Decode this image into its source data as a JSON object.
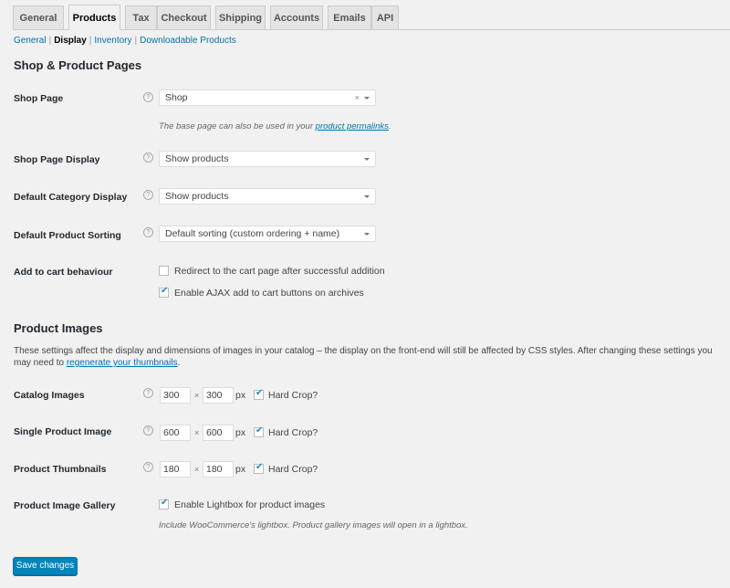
{
  "tabs": [
    {
      "label": "General",
      "active": false
    },
    {
      "label": "Products",
      "active": true
    },
    {
      "label": "Tax",
      "active": false
    },
    {
      "label": "Checkout",
      "active": false
    },
    {
      "label": "Shipping",
      "active": false
    },
    {
      "label": "Accounts",
      "active": false
    },
    {
      "label": "Emails",
      "active": false
    },
    {
      "label": "API",
      "active": false
    }
  ],
  "subnav": {
    "items": [
      "General",
      "Display",
      "Inventory",
      "Downloadable Products"
    ],
    "current": "Display",
    "separator": "|"
  },
  "shop_section": {
    "title": "Shop & Product Pages",
    "help_glyph": "?",
    "shop_page": {
      "label": "Shop Page",
      "value": "Shop",
      "clear_glyph": "×",
      "description_prefix": "The base page can also be used in your ",
      "description_link": "product permalinks",
      "description_suffix": "."
    },
    "shop_page_display": {
      "label": "Shop Page Display",
      "value": "Show products"
    },
    "default_category_display": {
      "label": "Default Category Display",
      "value": "Show products"
    },
    "default_product_sorting": {
      "label": "Default Product Sorting",
      "value": "Default sorting (custom ordering + name)"
    },
    "add_to_cart": {
      "label": "Add to cart behaviour",
      "options": [
        {
          "label": "Redirect to the cart page after successful addition",
          "checked": false
        },
        {
          "label": "Enable AJAX add to cart buttons on archives",
          "checked": true
        }
      ]
    }
  },
  "images_section": {
    "title": "Product Images",
    "intro": "These settings affect the display and dimensions of images in your catalog – the display on the front-end will still be affected by CSS styles. After changing these settings you may need to ",
    "intro_link": "regenerate your thumbnails",
    "intro_suffix": ".",
    "times_glyph": "×",
    "unit": "px",
    "hard_crop_label": "Hard Crop?",
    "rows": [
      {
        "label": "Catalog Images",
        "width": "300",
        "height": "300",
        "hard_crop": true
      },
      {
        "label": "Single Product Image",
        "width": "600",
        "height": "600",
        "hard_crop": true
      },
      {
        "label": "Product Thumbnails",
        "width": "180",
        "height": "180",
        "hard_crop": true
      }
    ],
    "gallery": {
      "label": "Product Image Gallery",
      "option": "Enable Lightbox for product images",
      "checked": true,
      "description": "Include WooCommerce's lightbox. Product gallery images will open in a lightbox."
    }
  },
  "save_button": "Save changes"
}
